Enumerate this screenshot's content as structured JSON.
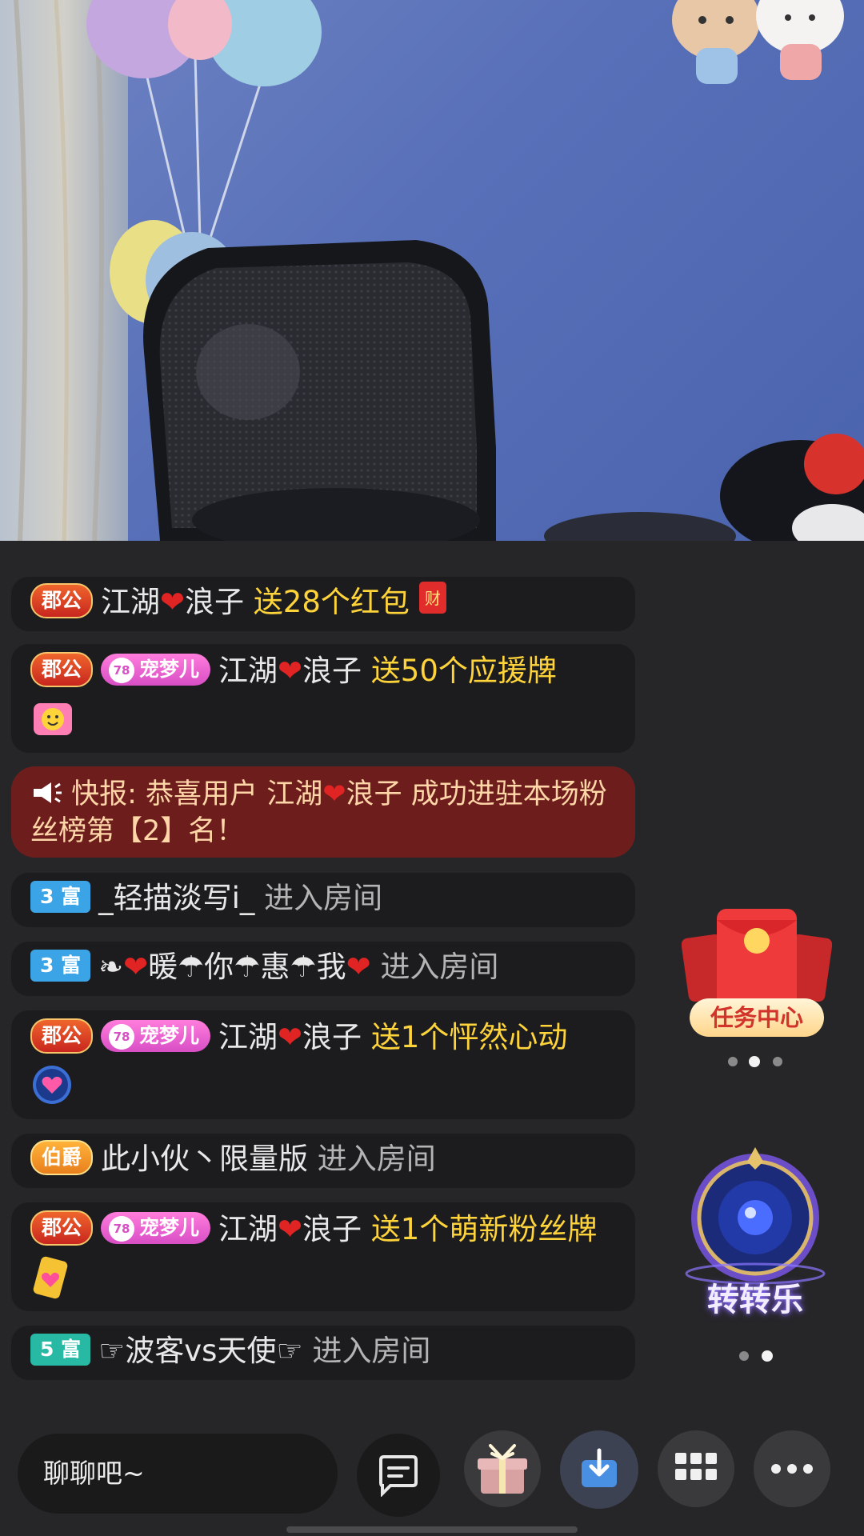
{
  "chat": {
    "messages": [
      {
        "badge1": "郡公",
        "user": "江湖",
        "user2": "浪子",
        "action": "送28个红包"
      },
      {
        "badge1": "郡公",
        "pet_level": "78",
        "pet": "宠梦儿",
        "user": "江湖",
        "user2": "浪子",
        "action": "送50个应援牌"
      },
      {
        "badge1": "3 富",
        "user": "_轻描淡写i_",
        "enter": "进入房间"
      },
      {
        "badge1": "3 富",
        "user": "暖☂你☂惠☂我",
        "enter": "进入房间"
      },
      {
        "badge1": "郡公",
        "pet_level": "78",
        "pet": "宠梦儿",
        "user": "江湖",
        "user2": "浪子",
        "action": "送1个怦然心动"
      },
      {
        "badge1": "伯爵",
        "user": "此小伙丶限量版",
        "enter": "进入房间"
      },
      {
        "badge1": "郡公",
        "pet_level": "78",
        "pet": "宠梦儿",
        "user": "江湖",
        "user2": "浪子",
        "action": "送1个萌新粉丝牌"
      },
      {
        "badge1": "5 富",
        "user": "☞波客vs天使☞",
        "enter": "进入房间"
      }
    ],
    "alert": {
      "prefix": "快报: 恭喜用户",
      "user": "江湖",
      "user2": "浪子",
      "text": "成功进驻本场粉丝榜第【2】名！"
    },
    "hongbao_char": "财"
  },
  "widgets": {
    "task_center_label": "任务中心",
    "wheel_label": "转转乐"
  },
  "bottom_bar": {
    "input_placeholder": "聊聊吧~"
  },
  "colors": {
    "gift_text": "#ffd43b",
    "alert_bg": "#6e1d1d",
    "chat_bubble": "#1c1c1e"
  }
}
